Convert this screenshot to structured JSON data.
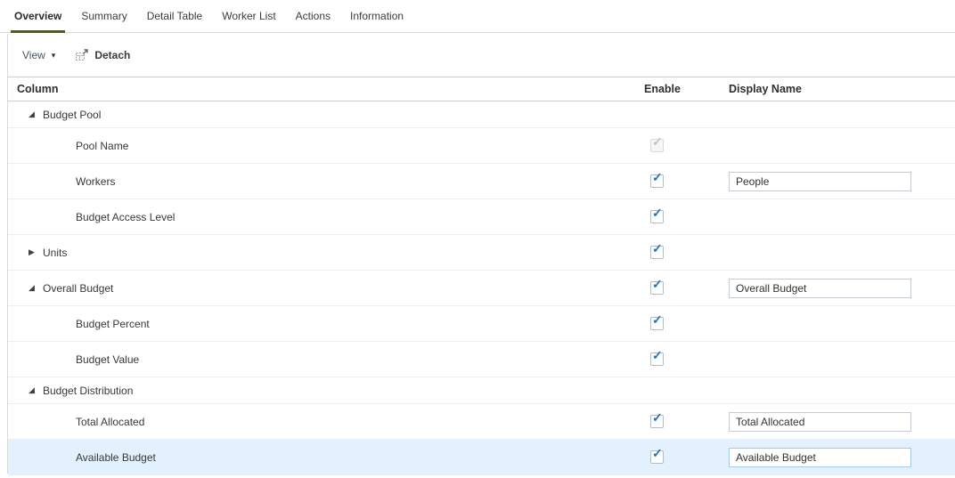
{
  "tabs": [
    {
      "label": "Overview",
      "active": true
    },
    {
      "label": "Summary",
      "active": false
    },
    {
      "label": "Detail Table",
      "active": false
    },
    {
      "label": "Worker List",
      "active": false
    },
    {
      "label": "Actions",
      "active": false
    },
    {
      "label": "Information",
      "active": false
    }
  ],
  "toolbar": {
    "view_label": "View",
    "view_arrow": "▾",
    "detach_label": "Detach"
  },
  "table": {
    "headers": {
      "column": "Column",
      "enable": "Enable",
      "display_name": "Display Name"
    },
    "rows": [
      {
        "label": "Budget Pool",
        "type": "group",
        "state": "expanded"
      },
      {
        "label": "Pool Name",
        "type": "leaf",
        "checkbox": "checked-disabled"
      },
      {
        "label": "Workers",
        "type": "leaf",
        "checkbox": "checked",
        "display_name": "People"
      },
      {
        "label": "Budget Access Level",
        "type": "leaf",
        "checkbox": "checked"
      },
      {
        "label": "Units",
        "type": "group",
        "state": "collapsed",
        "checkbox": "checked"
      },
      {
        "label": "Overall Budget",
        "type": "group",
        "state": "expanded",
        "checkbox": "checked",
        "display_name": "Overall Budget"
      },
      {
        "label": "Budget Percent",
        "type": "leaf",
        "checkbox": "checked"
      },
      {
        "label": "Budget Value",
        "type": "leaf",
        "checkbox": "checked"
      },
      {
        "label": "Budget Distribution",
        "type": "group",
        "state": "expanded"
      },
      {
        "label": "Total Allocated",
        "type": "leaf",
        "checkbox": "checked",
        "display_name": "Total Allocated"
      },
      {
        "label": "Available Budget",
        "type": "leaf",
        "checkbox": "checked",
        "display_name": "Available Budget",
        "selected": true
      }
    ]
  },
  "icons": {
    "expanded": "◢",
    "collapsed": "▶",
    "view_dropdown_arrow": "▾",
    "checkbox_check": "✓",
    "detach": "detach-window-icon"
  },
  "colors": {
    "active_tab_underline": "#4c5a2d",
    "checkbox_check_blue": "#1b72c8",
    "selected_row_bg": "#e2f1fd"
  }
}
